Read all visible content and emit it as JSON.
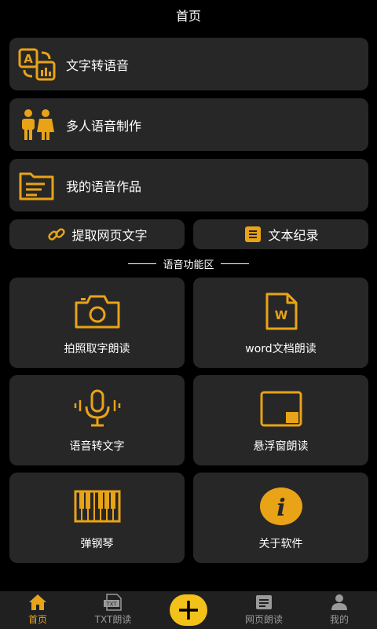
{
  "header": {
    "title": "首页"
  },
  "rows": [
    {
      "label": "文字转语音",
      "icon": "text-to-speech-icon"
    },
    {
      "label": "多人语音制作",
      "icon": "people-icon"
    },
    {
      "label": "我的语音作品",
      "icon": "folder-icon"
    }
  ],
  "quick": [
    {
      "label": "提取网页文字",
      "icon": "link-icon"
    },
    {
      "label": "文本纪录",
      "icon": "note-icon"
    }
  ],
  "section": {
    "title": "语音功能区"
  },
  "grid": [
    {
      "label": "拍照取字朗读",
      "icon": "camera-icon"
    },
    {
      "label": "word文档朗读",
      "icon": "word-document-icon",
      "doc_letter": "W"
    },
    {
      "label": "语音转文字",
      "icon": "microphone-icon"
    },
    {
      "label": "悬浮窗朗读",
      "icon": "floating-window-icon"
    },
    {
      "label": "弹钢琴",
      "icon": "piano-icon"
    },
    {
      "label": "关于软件",
      "icon": "info-icon",
      "info_letter": "i"
    }
  ],
  "tabs": [
    {
      "label": "首页",
      "icon": "home-icon",
      "active": true
    },
    {
      "label": "TXT朗读",
      "icon": "txt-file-icon",
      "badge": "TXT"
    },
    {
      "label": "",
      "icon": "plus-icon"
    },
    {
      "label": "网页朗读",
      "icon": "web-read-icon"
    },
    {
      "label": "我的",
      "icon": "user-icon"
    }
  ],
  "colors": {
    "accent": "#e8a317",
    "card": "#272727",
    "background": "#000000",
    "tabbar": "#202020",
    "plus": "#f2c21a"
  }
}
